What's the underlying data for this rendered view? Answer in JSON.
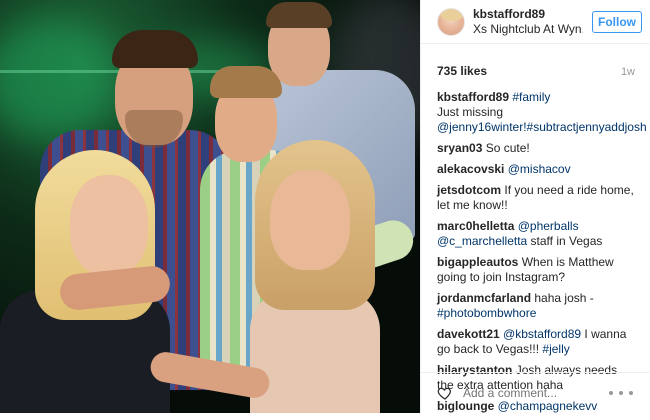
{
  "post": {
    "photo_alt": "",
    "colors": {
      "follow_blue": "#3897f0",
      "link_blue": "#003569",
      "muted": "#999999"
    }
  },
  "header": {
    "username": "kbstafford89",
    "location": "Xs Nightclub At Wyn...",
    "follow_label": "Follow"
  },
  "meta": {
    "likes": "735 likes",
    "time": "1w"
  },
  "caption": {
    "user": "kbstafford89",
    "hashtag": "#family",
    "text": "Just missing",
    "mention_line": "@jenny16winter!#subtractjennyaddjosh"
  },
  "comments": [
    {
      "user": "sryan03",
      "parts": [
        {
          "t": "So cute!",
          "link": false
        }
      ]
    },
    {
      "user": "alekacovski",
      "parts": [
        {
          "t": "@mishacov",
          "link": true
        }
      ]
    },
    {
      "user": "jetsdotcom",
      "parts": [
        {
          "t": "If you need a ride home, let me know!!",
          "link": false
        }
      ]
    },
    {
      "user": "marc0helletta",
      "parts": [
        {
          "t": "@pherballs",
          "link": true
        },
        {
          "t": " ",
          "link": false
        },
        {
          "t": "@c_marchelletta",
          "link": true
        },
        {
          "t": " staff in Vegas",
          "link": false
        }
      ]
    },
    {
      "user": "bigappleautos",
      "parts": [
        {
          "t": "When is Matthew going to join Instagram?",
          "link": false
        }
      ]
    },
    {
      "user": "jordanmcfarland",
      "parts": [
        {
          "t": "haha josh - ",
          "link": false
        },
        {
          "t": "#photobombwhore",
          "link": true
        }
      ]
    },
    {
      "user": "davekott21",
      "parts": [
        {
          "t": "@kbstafford89",
          "link": true
        },
        {
          "t": " I wanna go back to Vegas!!! ",
          "link": false
        },
        {
          "t": "#jelly",
          "link": true
        }
      ]
    },
    {
      "user": "hilarystanton",
      "parts": [
        {
          "t": "Josh always needs the extra attention haha",
          "link": false
        }
      ]
    },
    {
      "user": "biglounge",
      "parts": [
        {
          "t": "@champagnekevv",
          "link": true
        }
      ]
    }
  ],
  "footer": {
    "add_comment_placeholder": "Add a comment...",
    "like_icon": "heart-outline-icon",
    "more_icon": "more-dots-icon"
  }
}
